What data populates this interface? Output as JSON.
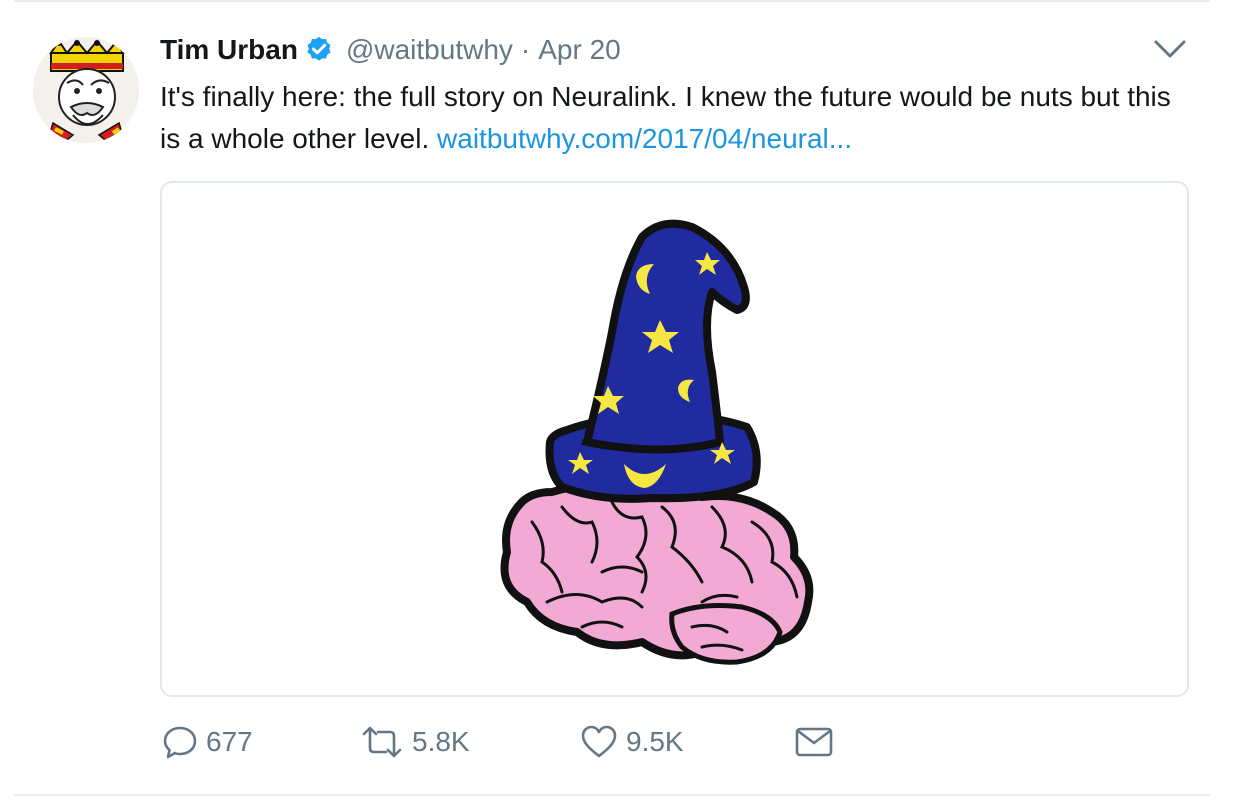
{
  "tweet": {
    "author": {
      "name": "Tim Urban",
      "handle": "@waitbutwhy",
      "verified": true,
      "avatar_icon": "king-card-avatar"
    },
    "separator": "·",
    "date": "Apr 20",
    "text": "It's finally here: the full story on Neuralink. I knew the future would be nuts but this is a whole other level.",
    "link": "waitbutwhy.com/2017/04/neural...",
    "media": {
      "description_icon": "wizard-hat-brain-image"
    },
    "actions": {
      "replies": "677",
      "retweets": "5.8K",
      "likes": "9.5K"
    }
  },
  "colors": {
    "text": "#14171a",
    "secondary": "#657786",
    "link": "#1b95e0",
    "verified": "#1da1f2",
    "divider": "#e6ecf0",
    "hat": "#1f2b9e",
    "stars": "#f5e642",
    "brain": "#f2a9d4"
  }
}
